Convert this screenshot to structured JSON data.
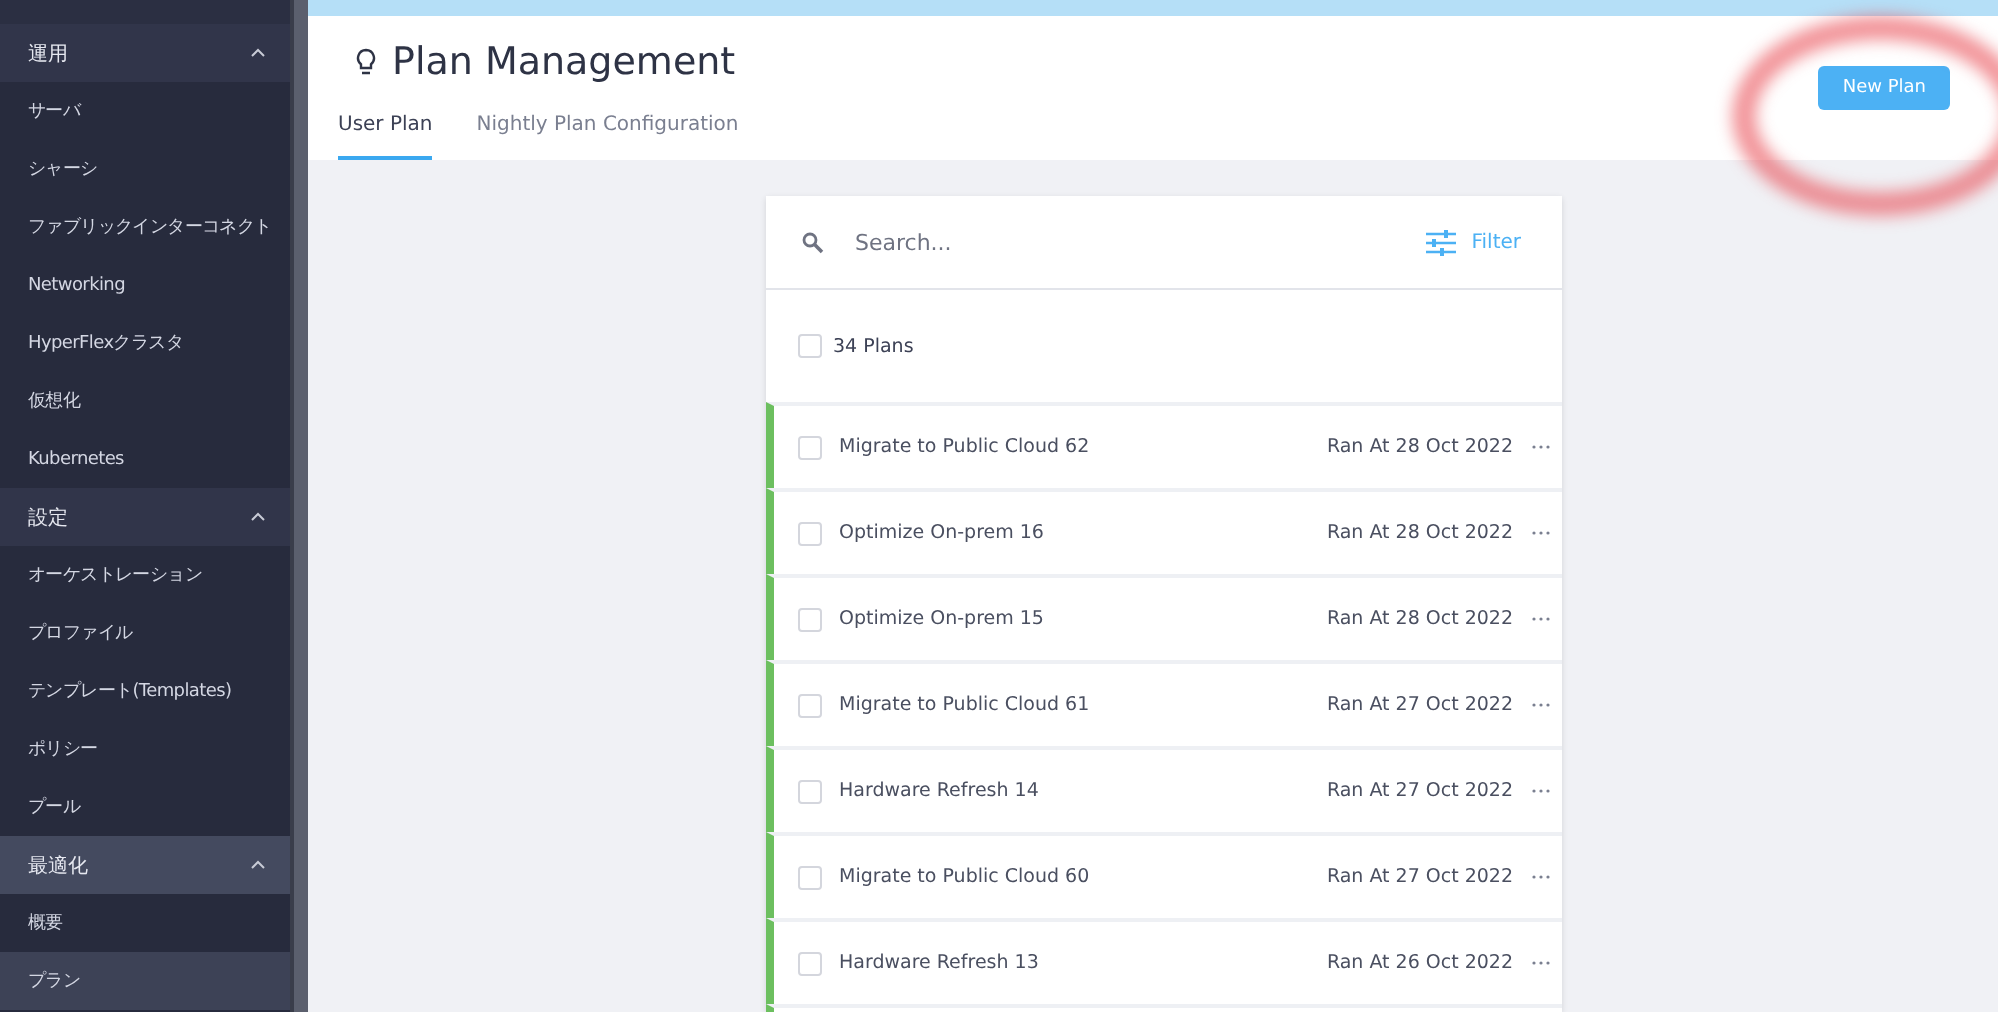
{
  "sidebar": {
    "groups": [
      {
        "label": "運用",
        "expanded": true,
        "selected": false,
        "items": [
          {
            "label": "サーバ",
            "selected": false
          },
          {
            "label": "シャーシ",
            "selected": false
          },
          {
            "label": "ファブリックインターコネクト",
            "selected": false
          },
          {
            "label": "Networking",
            "selected": false
          },
          {
            "label": "HyperFlexクラスタ",
            "selected": false
          },
          {
            "label": "仮想化",
            "selected": false
          },
          {
            "label": "Kubernetes",
            "selected": false
          }
        ]
      },
      {
        "label": "設定",
        "expanded": true,
        "selected": false,
        "items": [
          {
            "label": "オーケストレーション",
            "selected": false
          },
          {
            "label": "プロファイル",
            "selected": false
          },
          {
            "label": "テンプレート(Templates)",
            "selected": false
          },
          {
            "label": "ポリシー",
            "selected": false
          },
          {
            "label": "プール",
            "selected": false
          }
        ]
      },
      {
        "label": "最適化",
        "expanded": true,
        "selected": true,
        "items": [
          {
            "label": "概要",
            "selected": false
          },
          {
            "label": "プラン",
            "selected": true
          }
        ]
      }
    ]
  },
  "page": {
    "title": "Plan Management",
    "new_button": "New Plan",
    "tabs": [
      {
        "label": "User Plan",
        "selected": true
      },
      {
        "label": "Nightly Plan Configuration",
        "selected": false
      }
    ]
  },
  "plans": {
    "search": {
      "placeholder": "Search..."
    },
    "filter": "Filter",
    "count": "34 Plans",
    "all_checked": false,
    "rows": [
      {
        "name": "Migrate to Public Cloud 62",
        "ran": "Ran At 28 Oct 2022",
        "checked": false,
        "color": "#6cbf5f"
      },
      {
        "name": "Optimize On-prem 16",
        "ran": "Ran At 28 Oct 2022",
        "checked": false,
        "color": "#6cbf5f"
      },
      {
        "name": "Optimize On-prem 15",
        "ran": "Ran At 28 Oct 2022",
        "checked": false,
        "color": "#6cbf5f"
      },
      {
        "name": "Migrate to Public Cloud 61",
        "ran": "Ran At 27 Oct 2022",
        "checked": false,
        "color": "#6cbf5f"
      },
      {
        "name": "Hardware Refresh 14",
        "ran": "Ran At 27 Oct 2022",
        "checked": false,
        "color": "#6cbf5f"
      },
      {
        "name": "Migrate to Public Cloud 60",
        "ran": "Ran At 27 Oct 2022",
        "checked": false,
        "color": "#6cbf5f"
      },
      {
        "name": "Hardware Refresh 13",
        "ran": "Ran At 26 Oct 2022",
        "checked": false,
        "color": "#6cbf5f"
      }
    ]
  }
}
